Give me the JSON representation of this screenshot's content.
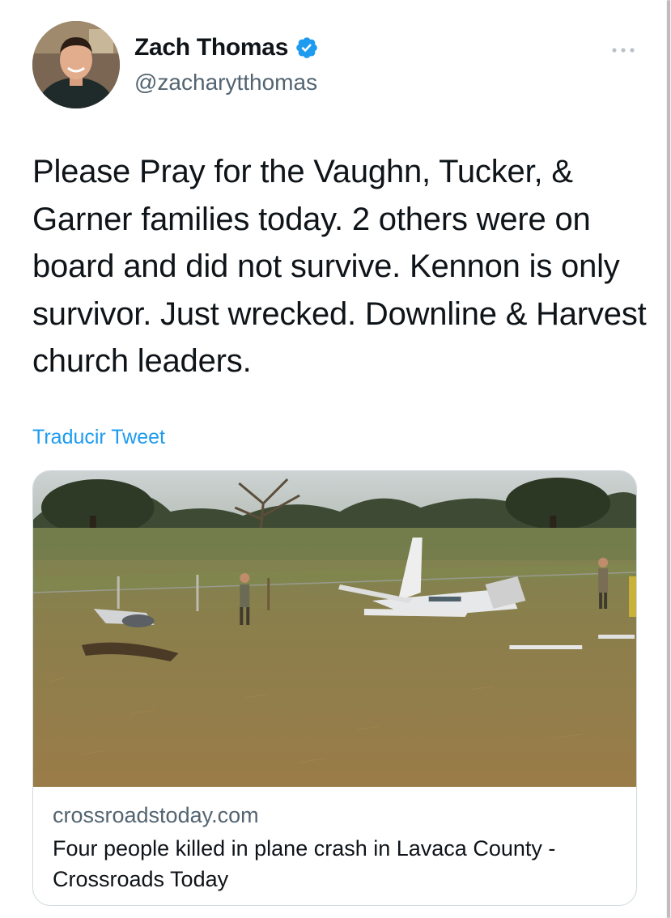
{
  "author": {
    "name": "Zach Thomas",
    "handle": "@zacharytthomas",
    "verified": true
  },
  "tweet": {
    "text": "Please Pray for the Vaughn, Tucker, & Garner families today. 2 others were on board and did not survive. Kennon is only survivor. Just wrecked. Downline & Harvest church leaders.",
    "translate_label": "Traducir Tweet"
  },
  "card": {
    "domain": "crossroadstoday.com",
    "title": "Four people killed in plane crash in Lavaca County - Crossroads Today",
    "image_alt": "Plane wreckage in a grassy field with responders"
  },
  "icons": {
    "verified": "verified-badge-icon",
    "more": "more-options-icon"
  },
  "colors": {
    "accent": "#1d9bf0",
    "text_primary": "#0f1419",
    "text_secondary": "#536471",
    "border": "#cfd9de"
  }
}
